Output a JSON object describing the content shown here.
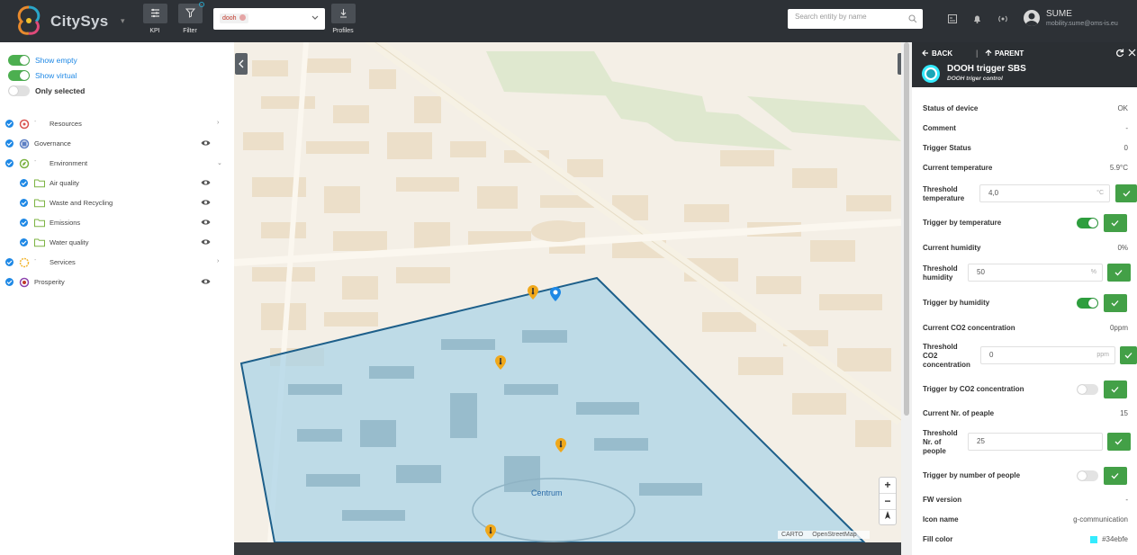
{
  "app": {
    "name": "CitySys"
  },
  "toolbar": {
    "kpi_label": "KPI",
    "filter_label": "Filter",
    "profile_chip": "dooh",
    "profiles_label": "Profiles"
  },
  "search": {
    "placeholder": "Search entity by name"
  },
  "user": {
    "name": "SUME",
    "email": "mobility.sume@oms-is.eu"
  },
  "toggles": [
    {
      "label": "Show empty",
      "state": "on"
    },
    {
      "label": "Show virtual",
      "state": "on"
    },
    {
      "label": "Only selected",
      "state": "off"
    }
  ],
  "tree": [
    {
      "label": "Resources"
    },
    {
      "label": "Governance"
    },
    {
      "label": "Environment"
    },
    {
      "label": "Air quality"
    },
    {
      "label": "Waste and Recycling"
    },
    {
      "label": "Emissions"
    },
    {
      "label": "Water quality"
    },
    {
      "label": "Services"
    },
    {
      "label": "Prosperity"
    }
  ],
  "map": {
    "area_label": "Centrum",
    "zoom_in": "+",
    "zoom_out": "−",
    "attribution": [
      "CARTO",
      "OpenStreetMap"
    ]
  },
  "panel": {
    "back_label": "BACK",
    "parent_label": "PARENT",
    "device_name": "DOOH trigger SBS",
    "device_subtitle": "DOOH triger control",
    "status": {
      "label": "Status of device",
      "value": "OK"
    },
    "comment": {
      "label": "Comment",
      "value": "-"
    },
    "trigger_status": {
      "label": "Trigger Status",
      "value": "0"
    },
    "current_temperature": {
      "label": "Current temperature",
      "value": "5.9°C"
    },
    "threshold_temperature": {
      "label_line1": "Threshold",
      "label_line2": "temperature",
      "value": "4,0",
      "unit": "°C"
    },
    "trigger_temperature": {
      "label": "Trigger by temperature",
      "state": "on"
    },
    "current_humidity": {
      "label": "Current humidity",
      "value": "0%"
    },
    "threshold_humidity": {
      "label_line1": "Threshold",
      "label_line2": "humidity",
      "value": "50",
      "unit": "%"
    },
    "trigger_humidity": {
      "label": "Trigger by humidity",
      "state": "on"
    },
    "current_co2": {
      "label": "Current CO2 concentration",
      "value": "0ppm"
    },
    "threshold_co2": {
      "label_line1": "Threshold",
      "label_line2": "CO2",
      "label_line3": "concentration",
      "value": "0",
      "unit": "ppm"
    },
    "trigger_co2": {
      "label": "Trigger by CO2 concentration",
      "state": "off"
    },
    "current_people": {
      "label": "Current Nr. of peaple",
      "value": "15"
    },
    "threshold_people": {
      "label_line1": "Threshold",
      "label_line2": "Nr. of",
      "label_line3": "people",
      "value": "25",
      "unit": ""
    },
    "trigger_people": {
      "label": "Trigger by number of people",
      "state": "off"
    },
    "fw_version": {
      "label": "FW version",
      "value": "-"
    },
    "icon_name": {
      "label": "Icon name",
      "value": "g-communication"
    },
    "fill_color": {
      "label": "Fill color",
      "value": "#34ebfe"
    }
  },
  "colors": {
    "topbar": "#2d3136",
    "accent_green": "#43a047",
    "accent_blue": "#1e88e5",
    "area_fill": "#a9d2e8",
    "area_border": "#1d5f8a",
    "device_color": "#34ebfe"
  }
}
